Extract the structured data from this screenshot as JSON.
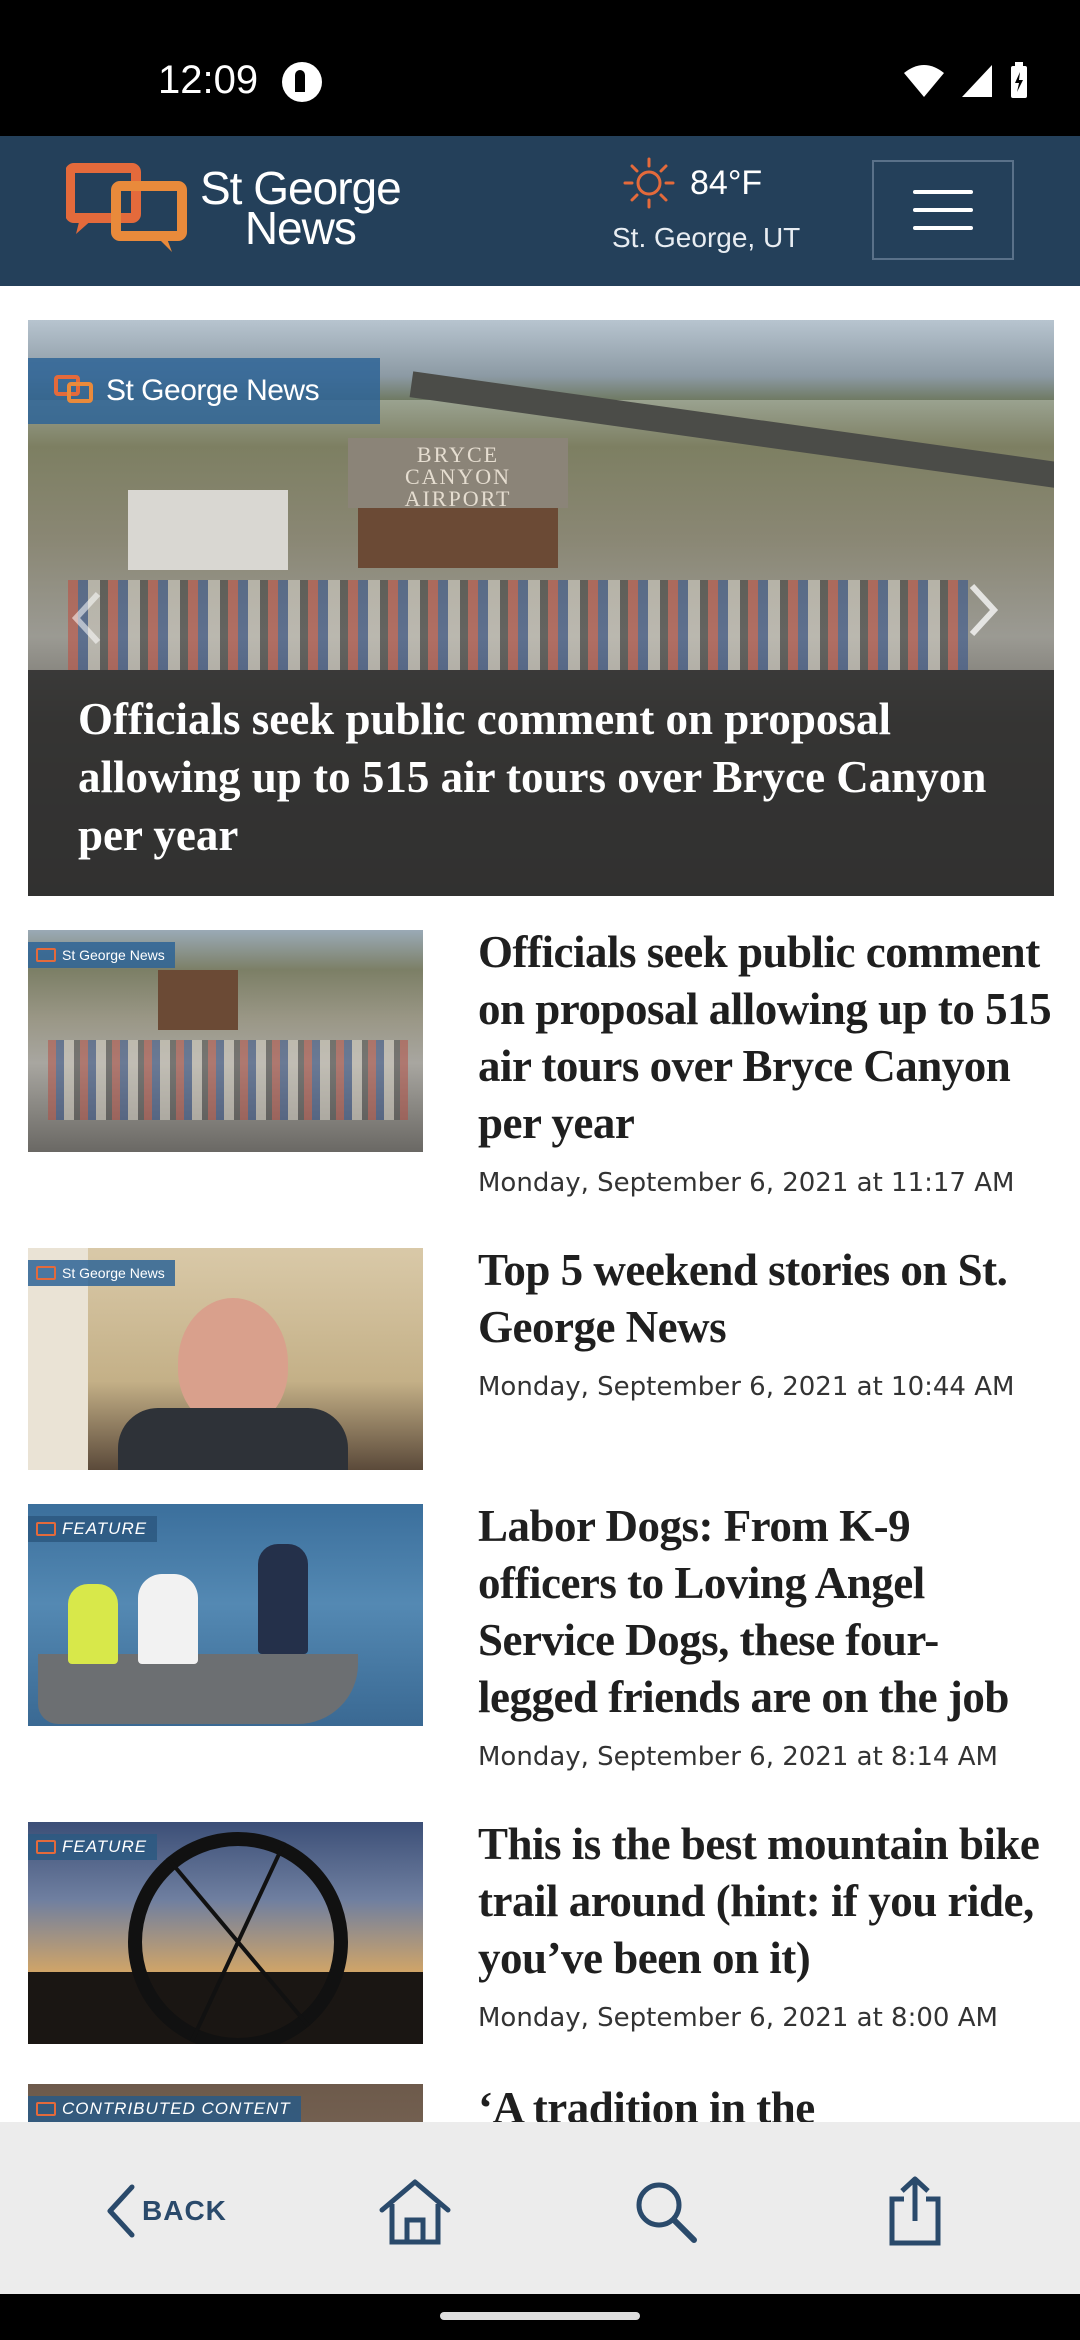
{
  "status_bar": {
    "time": "12:09"
  },
  "header": {
    "logo_line1": "St George",
    "logo_line2": "News",
    "weather_temp": "84°F",
    "weather_location": "St. George, UT"
  },
  "hero": {
    "badge": "St George News",
    "roof_text": "BRYCE CANYON AIRPORT",
    "title": "Officials seek public comment on proposal allowing up to 515 air tours over Bryce Canyon per year"
  },
  "articles": [
    {
      "tag": "St George News",
      "title": "Officials seek public comment on proposal allowing up to 515 air tours over Bryce Canyon per year",
      "date": "Monday, September 6, 2021 at 11:17 AM"
    },
    {
      "tag": "St George News",
      "title": "Top 5 weekend stories on St. George News",
      "date": "Monday, September 6, 2021 at 10:44 AM"
    },
    {
      "tag": "FEATURE",
      "title": "Labor Dogs: From K-9 officers to Loving Angel Service Dogs, these four-legged friends are on the job",
      "date": "Monday, September 6, 2021 at 8:14 AM"
    },
    {
      "tag": "FEATURE",
      "title": "This is the best mountain bike trail around (hint: if you ride, you’ve been on it)",
      "date": "Monday, September 6, 2021 at 8:00 AM"
    },
    {
      "tag": "CONTRIBUTED CONTENT",
      "title": "‘A tradition in the"
    }
  ],
  "bottom_nav": {
    "back_label": "BACK"
  },
  "colors": {
    "header_bg": "#24405a",
    "logo_orange": "#e46a3b",
    "nav_icon": "#2a4a6b"
  }
}
